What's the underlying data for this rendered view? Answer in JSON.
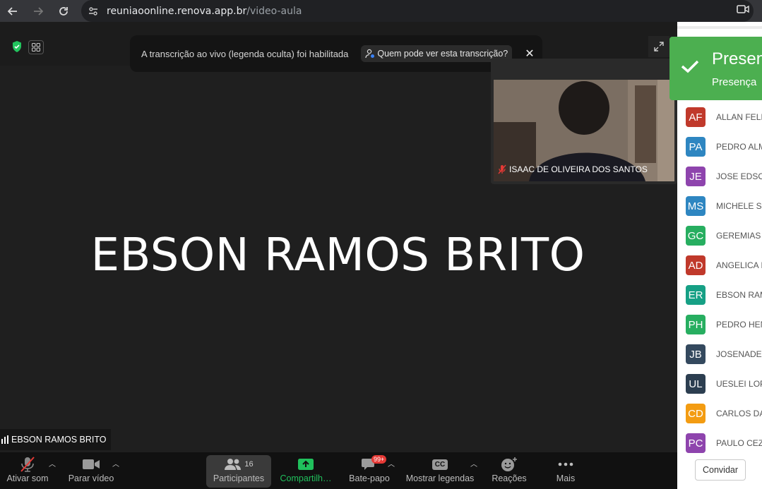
{
  "browser": {
    "url_host": "reuniaoonline.renova.app.br",
    "url_path": "/video-aula"
  },
  "toast": {
    "message": "A transcrição ao vivo (legenda oculta) foi habilitada",
    "button_label": "Quem pode ver esta transcrição?",
    "close_label": "✕"
  },
  "thumbnail": {
    "name": "ISAAC DE OLIVEIRA DOS SANTOS"
  },
  "main_speaker": {
    "big_name": "EBSON RAMOS BRITO",
    "tag_name": "EBSON RAMOS BRITO"
  },
  "toolbar": {
    "unmute_label": "Ativar som",
    "stop_video_label": "Parar vídeo",
    "participants_label": "Participantes",
    "participants_count": "16",
    "share_label": "Compartilh…",
    "chat_label": "Bate-papo",
    "chat_badge": "99+",
    "captions_label": "Mostrar legendas",
    "captions_icon_text": "CC",
    "reactions_label": "Reações",
    "more_label": "Mais"
  },
  "presence": {
    "title": "Presença",
    "subtitle": "Presença"
  },
  "participants": [
    {
      "initials": "AF",
      "name": "ALLAN FELI",
      "color": "#c0392b"
    },
    {
      "initials": "PA",
      "name": "PEDRO ALM",
      "color": "#2e86c1"
    },
    {
      "initials": "JE",
      "name": "JOSE EDSO",
      "color": "#8e44ad"
    },
    {
      "initials": "MS",
      "name": "MICHELE SI",
      "color": "#2e86c1"
    },
    {
      "initials": "GC",
      "name": "GEREMIAS C",
      "color": "#27ae60"
    },
    {
      "initials": "AD",
      "name": "ANGELICA I",
      "color": "#c0392b"
    },
    {
      "initials": "ER",
      "name": "EBSON RAM",
      "color": "#16a085"
    },
    {
      "initials": "PH",
      "name": "PEDRO HEN",
      "color": "#27ae60"
    },
    {
      "initials": "JB",
      "name": "JOSENADE",
      "color": "#34495e"
    },
    {
      "initials": "UL",
      "name": "UESLEI LOP",
      "color": "#2c3e50"
    },
    {
      "initials": "CD",
      "name": "CARLOS DA",
      "color": "#f39c12"
    },
    {
      "initials": "PC",
      "name": "PAULO CEZA",
      "color": "#8e44ad"
    }
  ],
  "invite_label": "Convidar"
}
